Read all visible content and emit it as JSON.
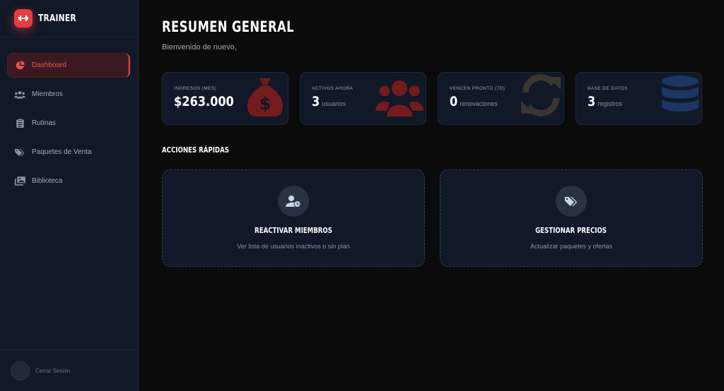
{
  "brand": {
    "name": "TRAINER",
    "accent": "#e53e3e"
  },
  "sidebar": {
    "items": [
      {
        "label": "Dashboard",
        "icon": "chart-pie-icon",
        "active": true
      },
      {
        "label": "Miembros",
        "icon": "users-icon",
        "active": false
      },
      {
        "label": "Rutinas",
        "icon": "clipboard-icon",
        "active": false
      },
      {
        "label": "Paquetes de Venta",
        "icon": "tags-icon",
        "active": false
      },
      {
        "label": "Biblioteca",
        "icon": "photo-library-icon",
        "active": false
      }
    ],
    "logout_label": "Cerrar Sesión"
  },
  "header": {
    "title": "RESUMEN GENERAL",
    "welcome": "Bienvenido de nuevo,"
  },
  "stats": [
    {
      "label": "INGRESOS (MES)",
      "value": "$263.000",
      "unit": "",
      "icon": "money-bag-icon",
      "icon_color": "#7f1d1d"
    },
    {
      "label": "ACTIVOS AHORA",
      "value": "3",
      "unit": "usuarios",
      "icon": "users-icon",
      "icon_color": "#7f1d1d"
    },
    {
      "label": "VENCEN PRONTO (7D)",
      "value": "0",
      "unit": "renovaciones",
      "icon": "sync-icon",
      "icon_color": "#3f3a30"
    },
    {
      "label": "BASE DE DATOS",
      "value": "3",
      "unit": "registros",
      "icon": "database-icon",
      "icon_color": "#1e3a6b"
    }
  ],
  "quick_actions": {
    "title": "ACCIONES RÁPIDAS",
    "items": [
      {
        "title": "REACTIVAR MIEMBROS",
        "description": "Ver lista de usuarios inactivos o sin plan",
        "icon": "user-clock-icon"
      },
      {
        "title": "GESTIONAR PRECIOS",
        "description": "Actualizar paquetes y ofertas",
        "icon": "tags-icon"
      }
    ]
  }
}
